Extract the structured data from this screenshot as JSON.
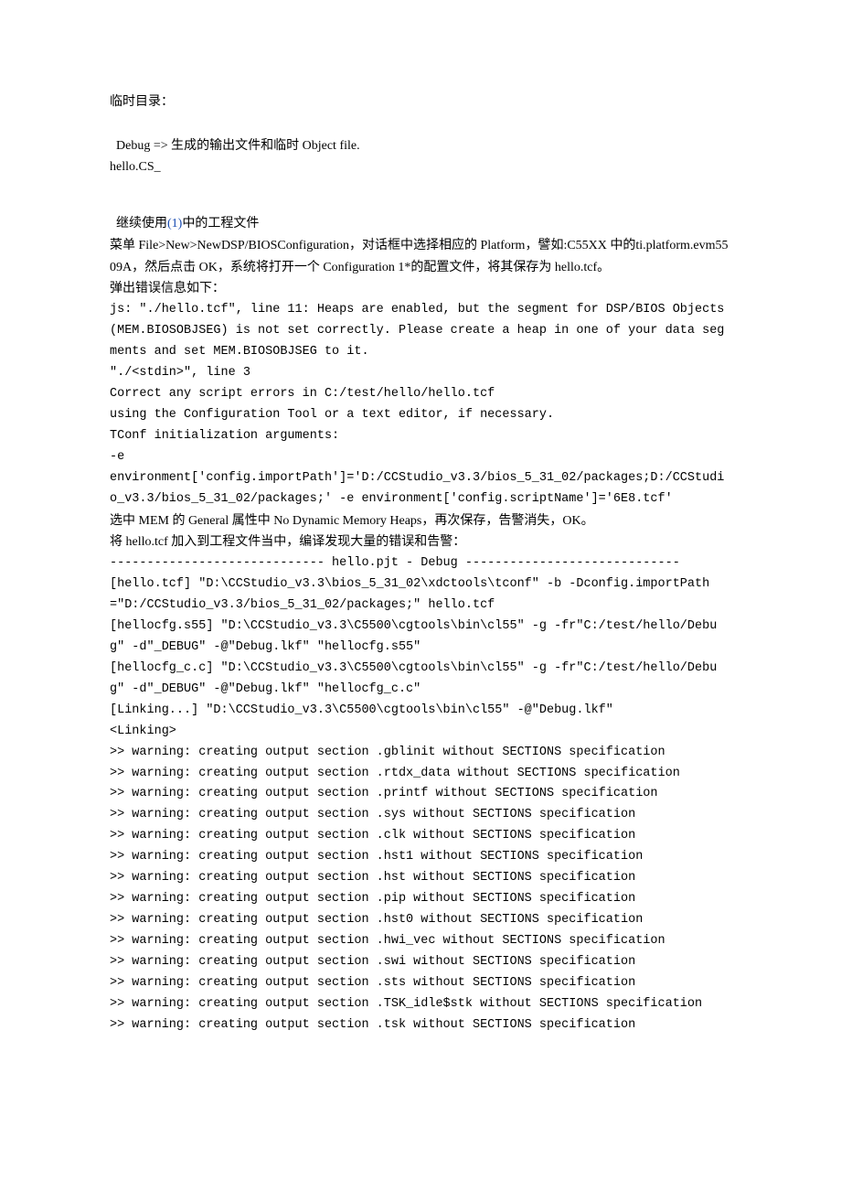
{
  "intro": {
    "l1": "临时目录：",
    "l2_pre": "Debug => ",
    "l2_rest": "生成的输出文件和临时 Object file.",
    "l3": "hello.CS_"
  },
  "setup": {
    "l1_pre": "继续使用",
    "l1_link": "(1)",
    "l1_post": "中的工程文件",
    "l2": "菜单 File>New>NewDSP/BIOSConfiguration，对话框中选择相应的 Platform，譬如:C55XX 中的ti.platform.evm5509A，然后点击 OK，系统将打开一个 Configuration 1*的配置文件，将其保存为 hello.tcf。",
    "l3": "弹出错误信息如下："
  },
  "err": {
    "l1": "js: \"./hello.tcf\", line 11: Heaps are enabled, but the segment for DSP/BIOS Objects (MEM.BIOSOBJSEG) is not set correctly. Please create a heap in one of your data segments and set MEM.BIOSOBJSEG to it.",
    "l2": "\"./<stdin>\", line 3",
    "l3": "Correct any script errors in C:/test/hello/hello.tcf",
    "l4": "using the Configuration Tool or a text editor, if necessary.",
    "l5": "TConf initialization arguments:",
    "l6": "-e",
    "l7": "environment['config.importPath']='D:/CCStudio_v3.3/bios_5_31_02/packages;D:/CCStudio_v3.3/bios_5_31_02/packages;' -e environment['config.scriptName']='6E8.tcf'"
  },
  "note": {
    "l1": "选中 MEM 的 General 属性中 No Dynamic Memory Heaps，再次保存，告警消失，OK。",
    "l2": "将 hello.tcf 加入到工程文件当中，编译发现大量的错误和告警："
  },
  "build": {
    "header": "----------------------------- hello.pjt - Debug -----------------------------",
    "l1": "[hello.tcf] \"D:\\CCStudio_v3.3\\bios_5_31_02\\xdctools\\tconf\" -b -Dconfig.importPath=\"D:/CCStudio_v3.3/bios_5_31_02/packages;\" hello.tcf",
    "l2": "[hellocfg.s55] \"D:\\CCStudio_v3.3\\C5500\\cgtools\\bin\\cl55\" -g -fr\"C:/test/hello/Debug\" -d\"_DEBUG\" -@\"Debug.lkf\" \"hellocfg.s55\"",
    "l3": "[hellocfg_c.c] \"D:\\CCStudio_v3.3\\C5500\\cgtools\\bin\\cl55\" -g -fr\"C:/test/hello/Debug\" -d\"_DEBUG\" -@\"Debug.lkf\" \"hellocfg_c.c\"",
    "l4": "[Linking...] \"D:\\CCStudio_v3.3\\C5500\\cgtools\\bin\\cl55\" -@\"Debug.lkf\"",
    "l5": "<Linking>"
  },
  "warn": {
    "w1": ">> warning: creating output section .gblinit without SECTIONS specification",
    "w2": ">> warning: creating output section .rtdx_data without SECTIONS specification",
    "w3": ">> warning: creating output section .printf without SECTIONS specification",
    "w4": ">> warning: creating output section .sys without SECTIONS specification",
    "w5": ">> warning: creating output section .clk without SECTIONS specification",
    "w6": ">> warning: creating output section .hst1 without SECTIONS specification",
    "w7": ">> warning: creating output section .hst without SECTIONS specification",
    "w8": ">> warning: creating output section .pip without SECTIONS specification",
    "w9": ">> warning: creating output section .hst0 without SECTIONS specification",
    "w10": ">> warning: creating output section .hwi_vec without SECTIONS specification",
    "w11": ">> warning: creating output section .swi without SECTIONS specification",
    "w12": ">> warning: creating output section .sts without SECTIONS specification",
    "w13": ">> warning: creating output section .TSK_idle$stk without SECTIONS specification",
    "w14": ">> warning: creating output section .tsk without SECTIONS specification"
  }
}
